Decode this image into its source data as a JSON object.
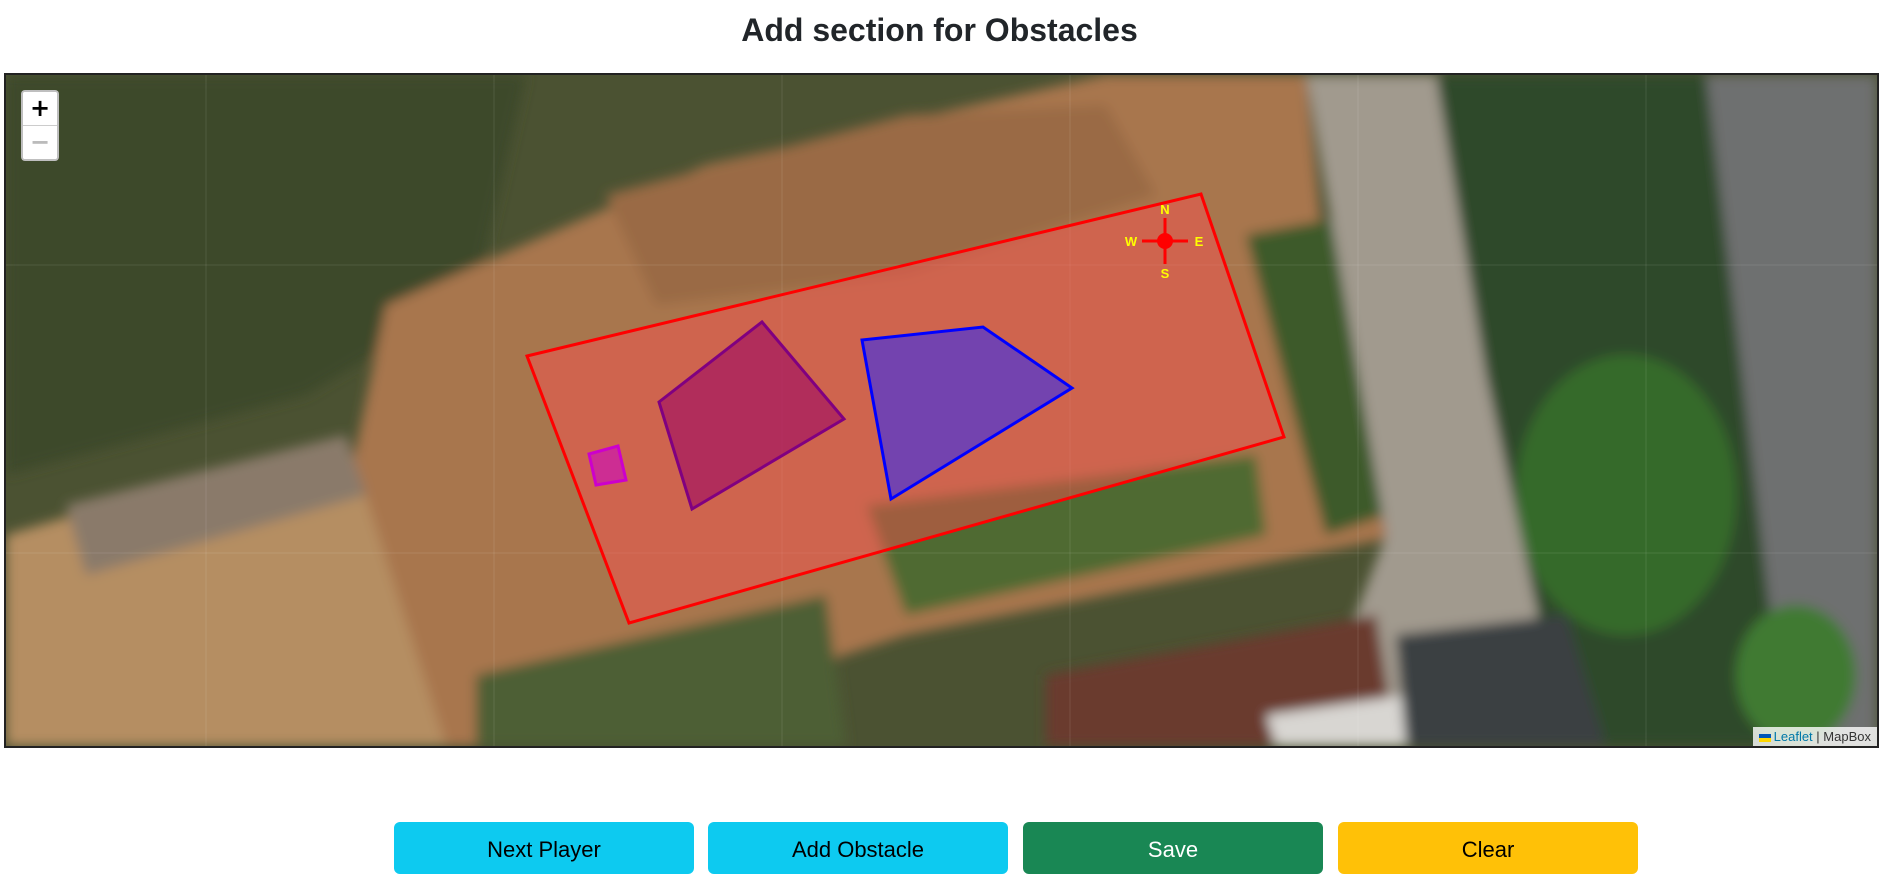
{
  "page": {
    "title": "Add section for Obstacles"
  },
  "map": {
    "zoom_in": "+",
    "zoom_out": "−",
    "attribution": {
      "leaflet": "Leaflet",
      "separator": " | ",
      "provider": "MapBox"
    },
    "compass": {
      "north": "N",
      "south": "S",
      "east": "E",
      "west": "W",
      "color": "#ff0000",
      "label_color": "#ffff00"
    },
    "field_color": "#ff0000",
    "obstacle_colors": [
      "#cc00cc",
      "#990066",
      "#0000ff"
    ]
  },
  "buttons": {
    "next_player": "Next Player",
    "add_obstacle": "Add Obstacle",
    "save": "Save",
    "clear": "Clear"
  }
}
